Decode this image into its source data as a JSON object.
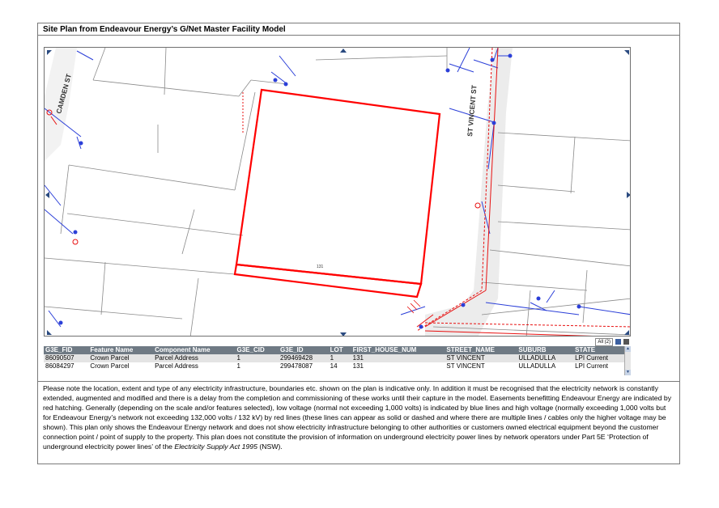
{
  "title": "Site Plan from Endeavour Energy’s G/Net Master Facility Model",
  "map": {
    "street_labels": [
      "CAMDEN ST",
      "ST VINCENT ST"
    ],
    "site_number": "131",
    "colors": {
      "parcel_boundary": "#8a8a8a",
      "site_outline": "#ff0000",
      "low_voltage": "#2b3fd8",
      "high_voltage": "#e81010",
      "road": "#ececec"
    }
  },
  "table": {
    "dropdown": "All (2)",
    "columns": [
      "G3E_FID",
      "Feature Name",
      "Component Name",
      "G3E_CID",
      "G3E_ID",
      "LOT",
      "FIRST_HOUSE_NUM",
      "STREET_NAME",
      "SUBURB",
      "STATE"
    ],
    "rows": [
      [
        "86090507",
        "Crown Parcel",
        "Parcel Address",
        "1",
        "299469428",
        "1",
        "131",
        "ST VINCENT",
        "ULLADULLA",
        "LPI Current"
      ],
      [
        "86084297",
        "Crown Parcel",
        "Parcel Address",
        "1",
        "299478087",
        "14",
        "131",
        "ST VINCENT",
        "ULLADULLA",
        "LPI Current"
      ]
    ]
  },
  "disclaimer": {
    "main": "Please note the location, extent and type of any electricity infrastructure, boundaries etc. shown on the plan is indicative only. In addition it must be recognised that the electricity network is constantly extended, augmented and modified and there is a delay from the completion and commissioning of these works until their capture in the model.  Easements benefitting Endeavour Energy are indicated by red hatching. Generally (depending on the scale and/or features selected), low voltage (normal not exceeding 1,000 volts) is indicated by blue lines and high voltage (normally exceeding 1,000 volts but for Endeavour Energy’s network not exceeding 132,000 volts / 132 kV) by red lines (these lines can appear as solid or dashed and where there are multiple lines / cables only the higher voltage may be shown). This plan only shows the Endeavour Energy network and does not show electricity infrastructure belonging to other authorities or customers owned electrical equipment beyond the customer connection point / point of supply to the property. This plan does not constitute the provision of information on underground electricity power lines by network operators under Part 5E ‘Protection of underground electricity power lines’ of the ",
    "act": "Electricity Supply Act 1995",
    "tail": " (NSW)."
  }
}
